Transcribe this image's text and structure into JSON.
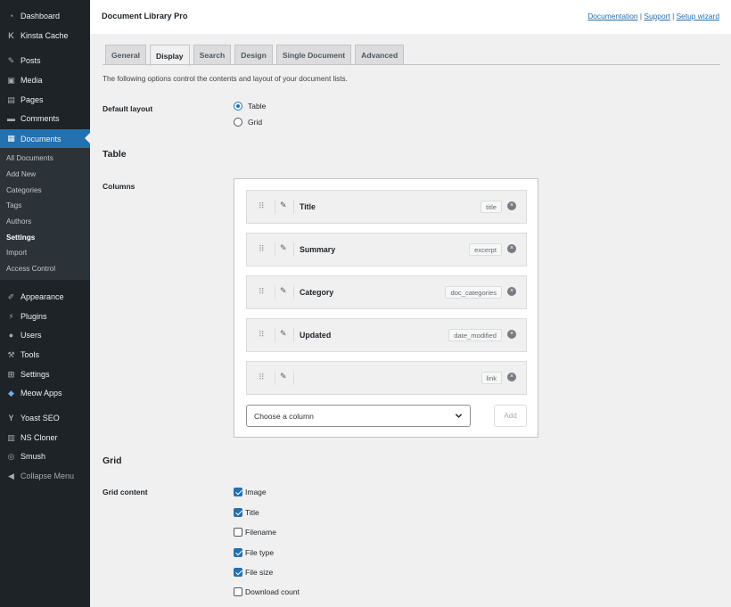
{
  "sidebar": {
    "dashboard": {
      "label": "Dashboard",
      "icon": "gauge-icon"
    },
    "kinsta": {
      "label": "Kinsta Cache",
      "icon": "kinsta-icon"
    },
    "posts": {
      "label": "Posts",
      "icon": "pin-icon"
    },
    "media": {
      "label": "Media",
      "icon": "media-icon"
    },
    "pages": {
      "label": "Pages",
      "icon": "page-icon"
    },
    "comments": {
      "label": "Comments",
      "icon": "comment-icon"
    },
    "documents": {
      "label": "Documents",
      "icon": "document-icon"
    },
    "submenu": {
      "all_documents": "All Documents",
      "add_new": "Add New",
      "categories": "Categories",
      "tags": "Tags",
      "authors": "Authors",
      "settings": "Settings",
      "import": "Import",
      "access_control": "Access Control"
    },
    "appearance": {
      "label": "Appearance",
      "icon": "brush-icon"
    },
    "plugins": {
      "label": "Plugins",
      "icon": "plug-icon"
    },
    "users": {
      "label": "Users",
      "icon": "user-icon"
    },
    "tools": {
      "label": "Tools",
      "icon": "wrench-icon"
    },
    "settings": {
      "label": "Settings",
      "icon": "settings-icon"
    },
    "meow": {
      "label": "Meow Apps",
      "icon": "cat-icon"
    },
    "yoast": {
      "label": "Yoast SEO",
      "icon": "yoast-icon"
    },
    "nscloner": {
      "label": "NS Cloner",
      "icon": "cloner-icon"
    },
    "smush": {
      "label": "Smush",
      "icon": "smush-icon"
    },
    "collapse": {
      "label": "Collapse Menu",
      "icon": "collapse-icon"
    }
  },
  "header": {
    "title": "Document Library Pro",
    "links": {
      "documentation": "Documentation",
      "support": "Support",
      "setup_wizard": "Setup wizard",
      "separator": "|"
    }
  },
  "tabs": {
    "general": "General",
    "display": "Display",
    "search": "Search",
    "design": "Design",
    "single_document": "Single Document",
    "advanced": "Advanced"
  },
  "intro": "The following options control the contents and layout of your document lists.",
  "default_layout": {
    "label": "Default layout",
    "options": {
      "table": "Table",
      "grid": "Grid"
    },
    "selected": "Table"
  },
  "table_section": {
    "heading": "Table",
    "columns_label": "Columns",
    "rows": [
      {
        "name": "Title",
        "key": "title"
      },
      {
        "name": "Summary",
        "key": "excerpt"
      },
      {
        "name": "Category",
        "key": "doc_categories"
      },
      {
        "name": "Updated",
        "key": "date_modified"
      },
      {
        "name": "",
        "key": "link"
      }
    ],
    "select": {
      "value": "Choose a column",
      "icon": "chevron-down-icon"
    },
    "add_label": "Add",
    "drag_glyph": "⠿",
    "edit_glyph": "✎",
    "remove_glyph": "×"
  },
  "grid_section": {
    "heading": "Grid",
    "content_label": "Grid content",
    "items": [
      {
        "label": "Image",
        "checked": true
      },
      {
        "label": "Title",
        "checked": true
      },
      {
        "label": "Filename",
        "checked": false
      },
      {
        "label": "File type",
        "checked": true
      },
      {
        "label": "File size",
        "checked": true
      },
      {
        "label": "Download count",
        "checked": false
      }
    ]
  },
  "colors": {
    "accent": "#2271b1",
    "sidebar": "#1d2327",
    "submenu": "#2c3338",
    "background": "#f0f0f1"
  }
}
